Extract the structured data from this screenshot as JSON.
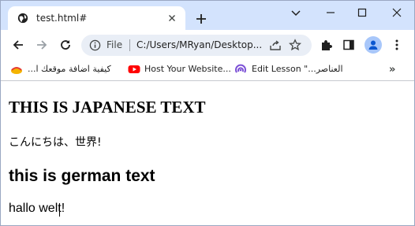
{
  "tab": {
    "title": "test.html#"
  },
  "toolbar": {
    "scheme": "File",
    "url": "C:/Users/MRyan/Desktop..."
  },
  "bookmarks": [
    {
      "label": "كيفية اضافة موقعك ا...",
      "icon": "wordpress-favicon"
    },
    {
      "label": "Host Your Website...",
      "icon": "youtube-icon"
    },
    {
      "label": "Edit Lesson \"...العناصر",
      "icon": "podcast-icon"
    }
  ],
  "page": {
    "heading_japanese": "THIS IS JAPANESE TEXT",
    "japanese_text": "こんにちは、世界!",
    "heading_german": "this is german text",
    "german_text": "hallo welt!"
  },
  "colors": {
    "tabstrip": "#d3e3fd",
    "omnibox": "#e9eef6",
    "icon": "#444746",
    "youtube": "#ff0000",
    "podcast": "#7b4fd6",
    "avatar": "#a8c7fa"
  }
}
